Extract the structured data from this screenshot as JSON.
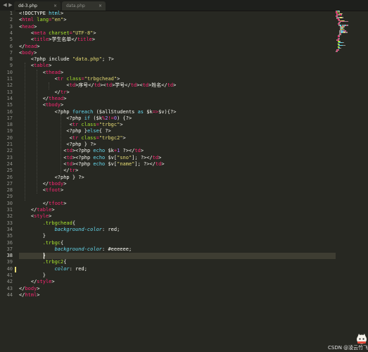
{
  "tabs": {
    "scroll_left": "◀",
    "scroll_right": "▶",
    "active": {
      "label": "dd-3.php",
      "close": "×"
    },
    "inactive": {
      "label": "data.php",
      "close": "×"
    }
  },
  "editor": {
    "active_line": 38,
    "modified_line": 40,
    "lines": [
      [
        [
          "t",
          "<!DOCTYPE "
        ],
        [
          "k",
          "html"
        ],
        [
          "t",
          ">"
        ]
      ],
      [
        [
          "t",
          "<"
        ],
        [
          "g",
          "html"
        ],
        [
          "a",
          " lang"
        ],
        [
          "o",
          "="
        ],
        [
          "s",
          "\"en\""
        ],
        [
          "t",
          ">"
        ]
      ],
      [
        [
          "t",
          "<"
        ],
        [
          "g",
          "head"
        ],
        [
          "t",
          ">"
        ]
      ],
      [
        [
          "t",
          "    <"
        ],
        [
          "g",
          "meta"
        ],
        [
          "a",
          " charset"
        ],
        [
          "o",
          "="
        ],
        [
          "s",
          "\"UTF-8\""
        ],
        [
          "t",
          ">"
        ]
      ],
      [
        [
          "t",
          "    <"
        ],
        [
          "g",
          "title"
        ],
        [
          "t",
          ">学生名单</"
        ],
        [
          "g",
          "title"
        ],
        [
          "t",
          ">"
        ]
      ],
      [
        [
          "t",
          "</"
        ],
        [
          "g",
          "head"
        ],
        [
          "t",
          ">"
        ]
      ],
      [
        [
          "t",
          "<"
        ],
        [
          "g",
          "body"
        ],
        [
          "t",
          ">"
        ]
      ],
      [
        [
          "t",
          "    <?php include "
        ],
        [
          "s",
          "\"data.php\""
        ],
        [
          "t",
          "; ?>"
        ]
      ],
      [
        [
          "t",
          "    <"
        ],
        [
          "g",
          "table"
        ],
        [
          "t",
          ">"
        ]
      ],
      [
        [
          "t",
          "        <"
        ],
        [
          "g",
          "thead"
        ],
        [
          "t",
          ">"
        ]
      ],
      [
        [
          "t",
          "            <"
        ],
        [
          "g",
          "tr"
        ],
        [
          "a",
          " class"
        ],
        [
          "o",
          "="
        ],
        [
          "s",
          "\"trbgchead\""
        ],
        [
          "t",
          ">"
        ]
      ],
      [
        [
          "t",
          "                <"
        ],
        [
          "g",
          "td"
        ],
        [
          "t",
          ">序号</"
        ],
        [
          "g",
          "td"
        ],
        [
          "t",
          "><"
        ],
        [
          "g",
          "td"
        ],
        [
          "t",
          ">学号</"
        ],
        [
          "g",
          "td"
        ],
        [
          "t",
          "><"
        ],
        [
          "g",
          "td"
        ],
        [
          "t",
          ">姓名</"
        ],
        [
          "g",
          "td"
        ],
        [
          "t",
          ">"
        ]
      ],
      [
        [
          "t",
          "            </"
        ],
        [
          "g",
          "tr"
        ],
        [
          "t",
          ">"
        ]
      ],
      [
        [
          "t",
          "        </"
        ],
        [
          "g",
          "thead"
        ],
        [
          "t",
          ">"
        ]
      ],
      [
        [
          "t",
          "        <"
        ],
        [
          "g",
          "tbody"
        ],
        [
          "t",
          ">"
        ]
      ],
      [
        [
          "t",
          "            <?php "
        ],
        [
          "k",
          "foreach"
        ],
        [
          "t",
          " ($allStudents "
        ],
        [
          "k",
          "as"
        ],
        [
          "t",
          " $k"
        ],
        [
          "o",
          "=>"
        ],
        [
          "t",
          "$v){?>"
        ]
      ],
      [
        [
          "t",
          "                <?php "
        ],
        [
          "k",
          "if"
        ],
        [
          "t",
          " ($k"
        ],
        [
          "o",
          "%"
        ],
        [
          "n",
          "2"
        ],
        [
          "o",
          "!="
        ],
        [
          "n",
          "0"
        ],
        [
          "t",
          ") {?>"
        ]
      ],
      [
        [
          "t",
          "                 <"
        ],
        [
          "g",
          "tr"
        ],
        [
          "a",
          " class"
        ],
        [
          "o",
          "="
        ],
        [
          "s",
          "\"trbgc\""
        ],
        [
          "t",
          ">"
        ]
      ],
      [
        [
          "t",
          "                <?php }"
        ],
        [
          "k",
          "else"
        ],
        [
          "t",
          "{ ?>"
        ]
      ],
      [
        [
          "t",
          "                 <"
        ],
        [
          "g",
          "tr"
        ],
        [
          "a",
          " class"
        ],
        [
          "o",
          "="
        ],
        [
          "s",
          "\"trbgc2\""
        ],
        [
          "t",
          ">"
        ]
      ],
      [
        [
          "t",
          "                <?php } ?>"
        ]
      ],
      [
        [
          "t",
          "               <"
        ],
        [
          "g",
          "td"
        ],
        [
          "t",
          "><?php "
        ],
        [
          "k",
          "echo"
        ],
        [
          "t",
          " $k"
        ],
        [
          "o",
          "+"
        ],
        [
          "n",
          "1"
        ],
        [
          "t",
          " ?></"
        ],
        [
          "g",
          "td"
        ],
        [
          "t",
          ">"
        ]
      ],
      [
        [
          "t",
          "               <"
        ],
        [
          "g",
          "td"
        ],
        [
          "t",
          "><?php "
        ],
        [
          "k",
          "echo"
        ],
        [
          "t",
          " $v["
        ],
        [
          "s",
          "\"sno\""
        ],
        [
          "t",
          "]; ?></"
        ],
        [
          "g",
          "td"
        ],
        [
          "t",
          ">"
        ]
      ],
      [
        [
          "t",
          "               <"
        ],
        [
          "g",
          "td"
        ],
        [
          "t",
          "><?php "
        ],
        [
          "k",
          "echo"
        ],
        [
          "t",
          " $v["
        ],
        [
          "s",
          "\"name\""
        ],
        [
          "t",
          "]; ?></"
        ],
        [
          "g",
          "td"
        ],
        [
          "t",
          ">"
        ]
      ],
      [
        [
          "t",
          "               </"
        ],
        [
          "g",
          "tr"
        ],
        [
          "t",
          ">"
        ]
      ],
      [
        [
          "t",
          "            <?php } ?>"
        ]
      ],
      [
        [
          "t",
          "        </"
        ],
        [
          "g",
          "tbody"
        ],
        [
          "t",
          ">"
        ]
      ],
      [
        [
          "t",
          "        <"
        ],
        [
          "g",
          "tfoot"
        ],
        [
          "t",
          ">"
        ]
      ],
      [
        [
          "t",
          ""
        ]
      ],
      [
        [
          "t",
          "        </"
        ],
        [
          "g",
          "tfoot"
        ],
        [
          "t",
          ">"
        ]
      ],
      [
        [
          "t",
          "    </"
        ],
        [
          "g",
          "table"
        ],
        [
          "t",
          ">"
        ]
      ],
      [
        [
          "t",
          "    <"
        ],
        [
          "g",
          "style"
        ],
        [
          "t",
          ">"
        ]
      ],
      [
        [
          "c",
          "        .trbgchead"
        ],
        [
          "t",
          "{"
        ]
      ],
      [
        [
          "p",
          "            background-color"
        ],
        [
          "t",
          ": "
        ],
        [
          "v",
          "red"
        ],
        [
          "t",
          ";"
        ]
      ],
      [
        [
          "t",
          "        }"
        ]
      ],
      [
        [
          "c",
          "        .trbgc"
        ],
        [
          "t",
          "{"
        ]
      ],
      [
        [
          "p",
          "            background-color"
        ],
        [
          "t",
          ": "
        ],
        [
          "v",
          "#eeeeee"
        ],
        [
          "t",
          ";"
        ]
      ],
      [
        [
          "t",
          "        }"
        ]
      ],
      [
        [
          "c",
          "        .trbgc2"
        ],
        [
          "t",
          "{"
        ]
      ],
      [
        [
          "p",
          "            color"
        ],
        [
          "t",
          ": "
        ],
        [
          "v",
          "red"
        ],
        [
          "t",
          ";"
        ]
      ],
      [
        [
          "t",
          "        }"
        ]
      ],
      [
        [
          "t",
          "    </"
        ],
        [
          "g",
          "style"
        ],
        [
          "t",
          ">"
        ]
      ],
      [
        [
          "t",
          "</"
        ],
        [
          "g",
          "body"
        ],
        [
          "t",
          ">"
        ]
      ],
      [
        [
          "t",
          "</"
        ],
        [
          "g",
          "html"
        ],
        [
          "t",
          ">"
        ]
      ]
    ]
  },
  "watermark": {
    "text": "CSDN @凌云竹飞扬",
    "logo": "mascot-icon"
  },
  "colors": {
    "background": "#272822",
    "tag": "#f92672",
    "attribute": "#a6e22e",
    "string": "#e6db74",
    "keyword": "#66d9ef",
    "number": "#ae81ff"
  }
}
